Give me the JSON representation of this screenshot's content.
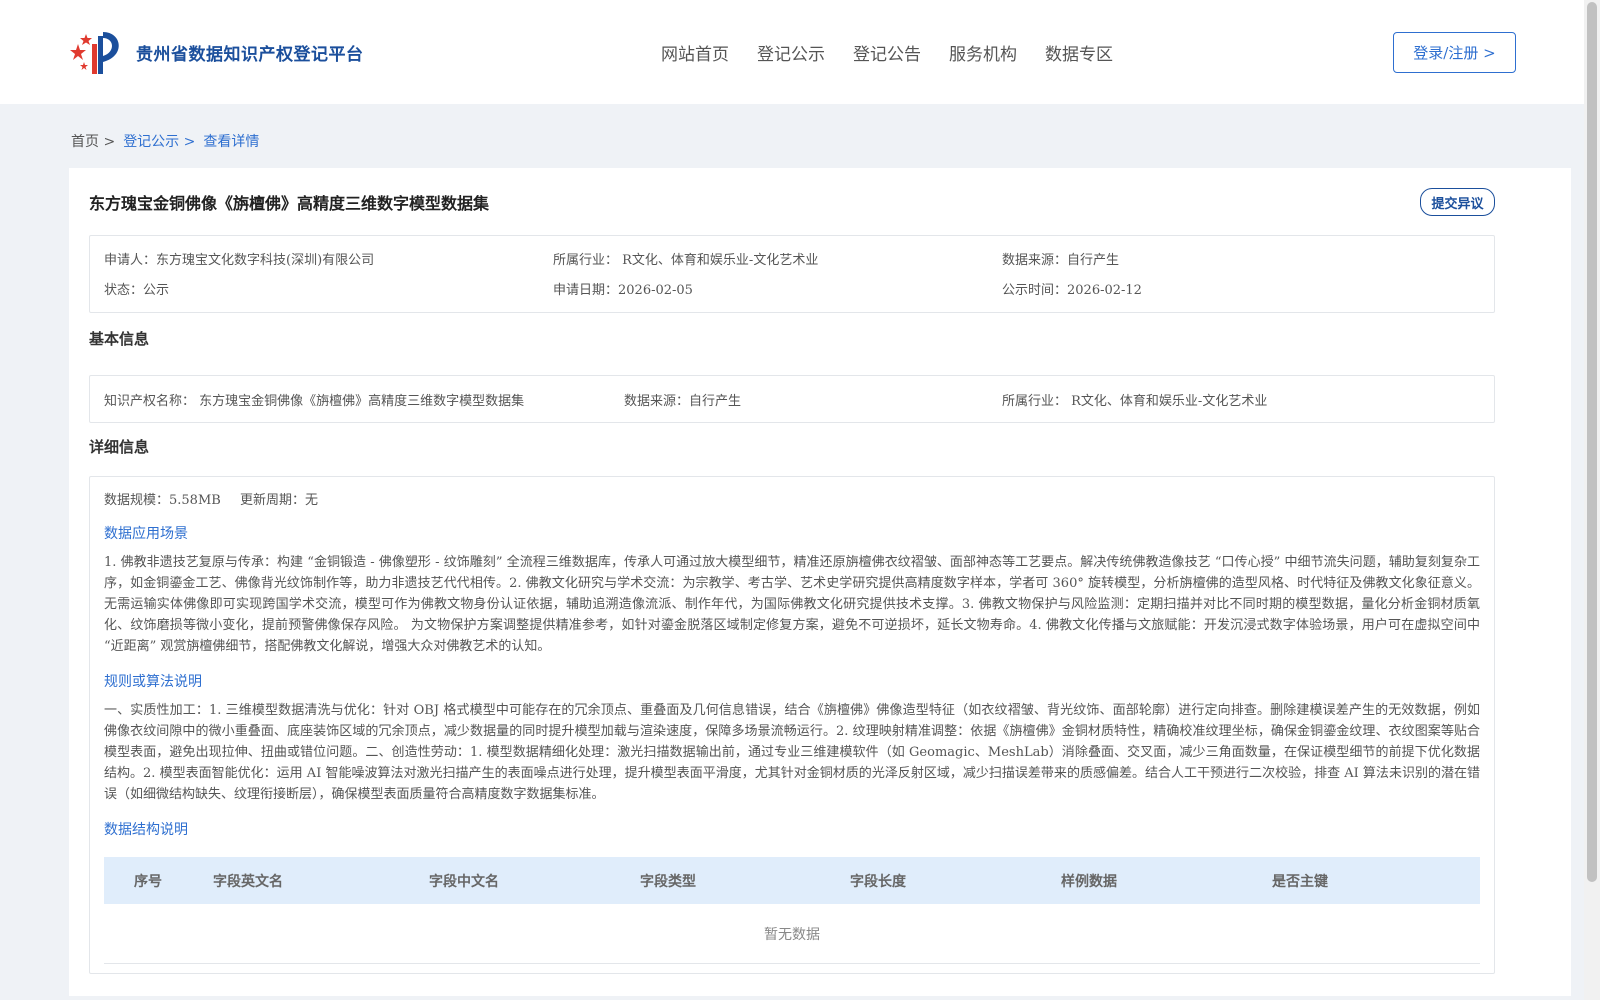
{
  "header": {
    "logo_text": "贵州省数据知识产权登记平台",
    "nav": [
      "网站首页",
      "登记公示",
      "登记公告",
      "服务机构",
      "数据专区"
    ],
    "login": "登录/注册 >"
  },
  "breadcrumb": {
    "home": "首页 >",
    "list": "登记公示 >",
    "current": "查看详情"
  },
  "record": {
    "title": "东方瑰宝金铜佛像《旃檀佛》高精度三维数字模型数据集",
    "objection": "提交异议",
    "applicant": "申请人：东方瑰宝文化数字科技(深圳)有限公司",
    "industry": "所属行业： R文化、体育和娱乐业-文化艺术业",
    "source": "数据来源：自行产生",
    "status": "状态：公示",
    "apply_date": "申请日期：2026-02-05",
    "publish_date": "公示时间：2026-02-12"
  },
  "basic": {
    "section": "基本信息",
    "ip_name": "知识产权名称： 东方瑰宝金铜佛像《旃檀佛》高精度三维数字模型数据集",
    "source": "数据来源：自行产生",
    "industry": "所属行业： R文化、体育和娱乐业-文化艺术业"
  },
  "detail": {
    "section": "详细信息",
    "scale": "数据规模：5.58MB",
    "period": "更新周期：无",
    "scenario_title": "数据应用场景",
    "scenario_text": "1. 佛教非遗技艺复原与传承：构建 “金铜锻造 - 佛像塑形 - 纹饰雕刻” 全流程三维数据库，传承人可通过放大模型细节，精准还原旃檀佛衣纹褶皱、面部神态等工艺要点。解决传统佛教造像技艺 “口传心授” 中细节流失问题，辅助复刻复杂工序，如金铜鎏金工艺、佛像背光纹饰制作等，助力非遗技艺代代相传。2. 佛教文化研究与学术交流：为宗教学、考古学、艺术史学研究提供高精度数字样本，学者可 360° 旋转模型，分析旃檀佛的造型风格、时代特征及佛教文化象征意义。无需运输实体佛像即可实现跨国学术交流，模型可作为佛教文物身份认证依据，辅助追溯造像流派、制作年代，为国际佛教文化研究提供技术支撑。3. 佛教文物保护与风险监测：定期扫描并对比不同时期的模型数据，量化分析金铜材质氧化、纹饰磨损等微小变化，提前预警佛像保存风险。 为文物保护方案调整提供精准参考，如针对鎏金脱落区域制定修复方案，避免不可逆损坏，延长文物寿命。4. 佛教文化传播与文旅赋能：开发沉浸式数字体验场景，用户可在虚拟空间中 “近距离” 观赏旃檀佛细节，搭配佛教文化解说，增强大众对佛教艺术的认知。",
    "rule_title": "规则或算法说明",
    "rule_text": "一、实质性加工：1. 三维模型数据清洗与优化：针对 OBJ 格式模型中可能存在的冗余顶点、重叠面及几何信息错误，结合《旃檀佛》佛像造型特征（如衣纹褶皱、背光纹饰、面部轮廓）进行定向排查。删除建模误差产生的无效数据，例如佛像衣纹间隙中的微小重叠面、底座装饰区域的冗余顶点，减少数据量的同时提升模型加载与渲染速度，保障多场景流畅运行。2. 纹理映射精准调整：依据《旃檀佛》金铜材质特性，精确校准纹理坐标，确保金铜鎏金纹理、衣纹图案等贴合模型表面，避免出现拉伸、扭曲或错位问题。二、创造性劳动：1. 模型数据精细化处理：激光扫描数据输出前，通过专业三维建模软件（如 Geomagic、MeshLab）消除叠面、交叉面，减少三角面数量，在保证模型细节的前提下优化数据结构。2. 模型表面智能优化：运用 AI 智能噪波算法对激光扫描产生的表面噪点进行处理，提升模型表面平滑度，尤其针对金铜材质的光泽反射区域，减少扫描误差带来的质感偏差。结合人工干预进行二次校验，排查 AI 算法未识别的潜在错误（如细微结构缺失、纹理衔接断层），确保模型表面质量符合高精度数字数据集标准。",
    "structure_title": "数据结构说明",
    "table_headers": [
      "序号",
      "字段英文名",
      "字段中文名",
      "字段类型",
      "字段长度",
      "样例数据",
      "是否主键"
    ],
    "empty": "暂无数据"
  }
}
